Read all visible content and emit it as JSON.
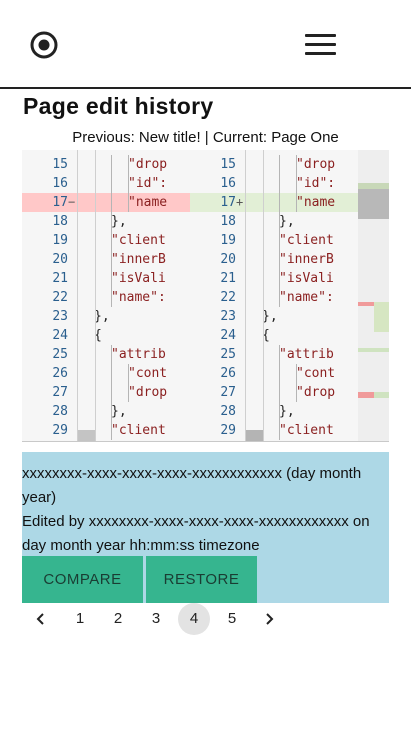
{
  "header": {
    "logo_icon": "target-icon",
    "menu_icon": "hamburger-menu-icon"
  },
  "page": {
    "title": "Page edit history",
    "compare_text": "Previous: New title! | Current: Page One"
  },
  "diff": {
    "left": {
      "lines": [
        {
          "num": "15",
          "mark": "",
          "text": "\"drop",
          "indent": 4,
          "state": "normal"
        },
        {
          "num": "16",
          "mark": "",
          "text": "\"id\":",
          "indent": 4,
          "state": "normal"
        },
        {
          "num": "17",
          "mark": "−",
          "text": "\"name",
          "indent": 4,
          "state": "removed"
        },
        {
          "num": "18",
          "mark": "",
          "text": "},",
          "indent": 3,
          "state": "normal"
        },
        {
          "num": "19",
          "mark": "",
          "text": "\"client",
          "indent": 3,
          "state": "normal"
        },
        {
          "num": "20",
          "mark": "",
          "text": "\"innerB",
          "indent": 3,
          "state": "normal"
        },
        {
          "num": "21",
          "mark": "",
          "text": "\"isVali",
          "indent": 3,
          "state": "normal"
        },
        {
          "num": "22",
          "mark": "",
          "text": "\"name\":",
          "indent": 3,
          "state": "normal"
        },
        {
          "num": "23",
          "mark": "",
          "text": "},",
          "indent": 2,
          "state": "normal"
        },
        {
          "num": "24",
          "mark": "",
          "text": "{",
          "indent": 2,
          "state": "normal"
        },
        {
          "num": "25",
          "mark": "",
          "text": "\"attrib",
          "indent": 3,
          "state": "normal"
        },
        {
          "num": "26",
          "mark": "",
          "text": "\"cont",
          "indent": 4,
          "state": "normal"
        },
        {
          "num": "27",
          "mark": "",
          "text": "\"drop",
          "indent": 4,
          "state": "normal"
        },
        {
          "num": "28",
          "mark": "",
          "text": "},",
          "indent": 3,
          "state": "normal"
        },
        {
          "num": "29",
          "mark": "",
          "text": "\"client",
          "indent": 3,
          "state": "normal"
        }
      ]
    },
    "right": {
      "lines": [
        {
          "num": "15",
          "mark": "",
          "text": "\"drop",
          "indent": 4,
          "state": "normal"
        },
        {
          "num": "16",
          "mark": "",
          "text": "\"id\":",
          "indent": 4,
          "state": "normal"
        },
        {
          "num": "17",
          "mark": "+",
          "text": "\"name",
          "indent": 4,
          "state": "added"
        },
        {
          "num": "18",
          "mark": "",
          "text": "},",
          "indent": 3,
          "state": "normal"
        },
        {
          "num": "19",
          "mark": "",
          "text": "\"client",
          "indent": 3,
          "state": "normal"
        },
        {
          "num": "20",
          "mark": "",
          "text": "\"innerB",
          "indent": 3,
          "state": "normal"
        },
        {
          "num": "21",
          "mark": "",
          "text": "\"isVali",
          "indent": 3,
          "state": "normal"
        },
        {
          "num": "22",
          "mark": "",
          "text": "\"name\":",
          "indent": 3,
          "state": "normal"
        },
        {
          "num": "23",
          "mark": "",
          "text": "},",
          "indent": 2,
          "state": "normal"
        },
        {
          "num": "24",
          "mark": "",
          "text": "{",
          "indent": 2,
          "state": "normal"
        },
        {
          "num": "25",
          "mark": "",
          "text": "\"attrib",
          "indent": 3,
          "state": "normal"
        },
        {
          "num": "26",
          "mark": "",
          "text": "\"cont",
          "indent": 4,
          "state": "normal"
        },
        {
          "num": "27",
          "mark": "",
          "text": "\"drop",
          "indent": 4,
          "state": "normal"
        },
        {
          "num": "28",
          "mark": "",
          "text": "},",
          "indent": 3,
          "state": "normal"
        },
        {
          "num": "29",
          "mark": "",
          "text": "\"client",
          "indent": 3,
          "state": "normal"
        }
      ]
    },
    "colors": {
      "removed_bg": "#ffc8c8",
      "added_bg": "#e2efd6",
      "string_color": "#8a1f1f",
      "line_number_color": "#2a5f8e"
    }
  },
  "history_item": {
    "title": "xxxxxxxx-xxxx-xxxx-xxxx-xxxxxxxxxxxx (day month year)",
    "meta": "Edited by xxxxxxxx-xxxx-xxxx-xxxx-xxxxxxxxxxxx on day month year hh:mm:ss timezone",
    "compare_label": "COMPARE",
    "restore_label": "RESTORE",
    "bg_color": "#add8e6",
    "button_color": "#36b58f"
  },
  "pagination": {
    "pages": [
      "1",
      "2",
      "3",
      "4",
      "5"
    ],
    "current": "4",
    "prev_icon": "chevron-left-icon",
    "next_icon": "chevron-right-icon"
  }
}
